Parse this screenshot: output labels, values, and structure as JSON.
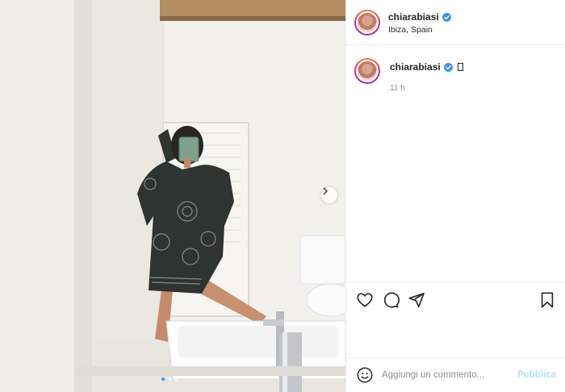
{
  "colors": {
    "accent": "#3897f0",
    "publish_disabled": "#b2dffc",
    "muted": "#8e8e8e",
    "text": "#262626"
  },
  "post": {
    "username": "chiarabiasi",
    "location": "Ibiza, Spain",
    "verified_icon": "verified-badge-icon",
    "image_count": 3,
    "active_image": 1
  },
  "caption": {
    "username": "chiarabiasi",
    "time": "11 h"
  },
  "actions": {
    "like_icon": "heart-icon",
    "comment_icon": "comment-bubble-icon",
    "share_icon": "paper-plane-icon",
    "save_icon": "bookmark-icon"
  },
  "comment_bar": {
    "emoji_icon": "smiley-icon",
    "placeholder": "Aggiungi un commento...",
    "publish_label": "Pubblica"
  },
  "carousel": {
    "next_icon": "chevron-right-icon"
  }
}
